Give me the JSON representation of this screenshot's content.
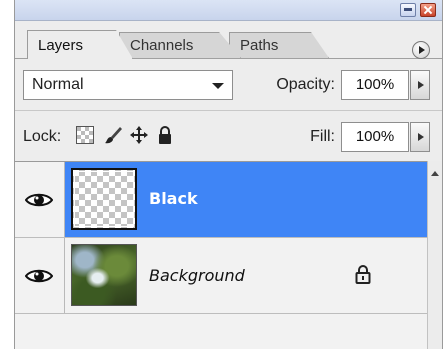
{
  "panel": {
    "tabs": [
      "Layers",
      "Channels",
      "Paths"
    ]
  },
  "controls": {
    "blend_mode": "Normal",
    "opacity_label": "Opacity:",
    "opacity_value": "100%",
    "lock_label": "Lock:",
    "fill_label": "Fill:",
    "fill_value": "100%"
  },
  "layers": [
    {
      "name": "Black",
      "selected": true,
      "visible": true,
      "thumbnail": "transparent-checkerboard"
    },
    {
      "name": "Background",
      "selected": false,
      "visible": true,
      "locked": true,
      "thumbnail": "photo"
    }
  ],
  "colors": {
    "selection": "#3f85f6",
    "panel_bg": "#ededed"
  }
}
